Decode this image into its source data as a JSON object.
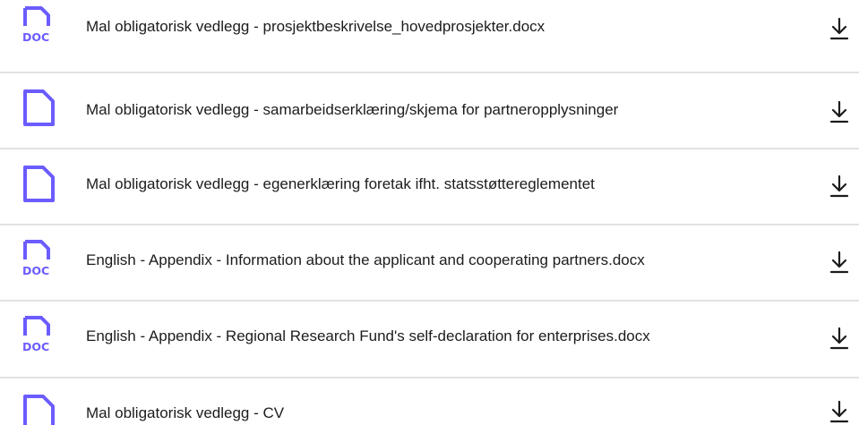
{
  "colors": {
    "icon_accent": "#6b5cff",
    "text": "#1c1c1c",
    "divider": "#e2e2e2"
  },
  "files": [
    {
      "name": "Mal obligatorisk vedlegg - prosjektbeskrivelse_hovedprosjekter.docx",
      "icon": "doc-file-icon",
      "badge": "DOC"
    },
    {
      "name": "Mal obligatorisk vedlegg - samarbeidserklæring/skjema for partneropplysninger",
      "icon": "blank-file-icon",
      "badge": ""
    },
    {
      "name": "Mal obligatorisk vedlegg - egenerklæring foretak ifht. statsstøttereglementet",
      "icon": "blank-file-icon",
      "badge": ""
    },
    {
      "name": "English - Appendix - Information about the applicant and cooperating partners.docx",
      "icon": "doc-file-icon",
      "badge": "DOC"
    },
    {
      "name": "English - Appendix - Regional Research Fund's self-declaration for enterprises.docx",
      "icon": "doc-file-icon",
      "badge": "DOC"
    },
    {
      "name": "Mal obligatorisk vedlegg - CV",
      "icon": "blank-file-icon",
      "badge": ""
    }
  ],
  "download_icon": "download-arrow-icon"
}
